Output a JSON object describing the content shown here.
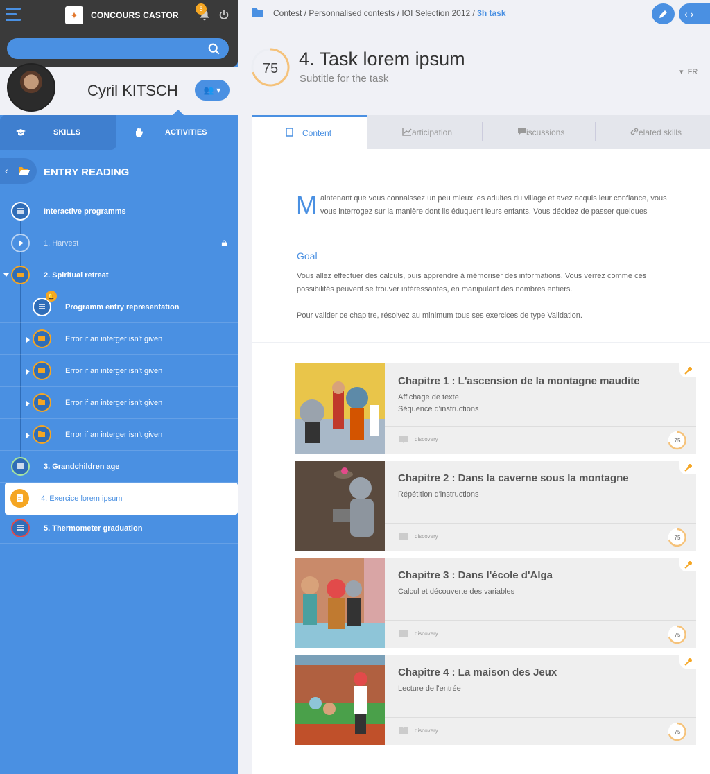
{
  "app": {
    "title": "CONCOURS CASTOR",
    "notification_count": "5"
  },
  "search": {
    "value": ""
  },
  "user": {
    "name": "Cyril KITSCH"
  },
  "tabs": {
    "skills": "SKILLS",
    "activities": "ACTIVITIES"
  },
  "sidebar": {
    "section_title": "ENTRY READING",
    "items": [
      {
        "label": "Interactive programms"
      },
      {
        "label": "1. Harvest"
      },
      {
        "label": "2. Spiritual retreat"
      },
      {
        "label": "Programm entry representation"
      },
      {
        "label": "Error if an interger isn't given"
      },
      {
        "label": "Error if an interger isn't given"
      },
      {
        "label": "Error if an interger isn't given"
      },
      {
        "label": "Error if an interger isn't given"
      },
      {
        "label": "3. Grandchildren age"
      },
      {
        "label": "4. Exercice lorem ipsum"
      },
      {
        "label": "5. Thermometer graduation"
      }
    ]
  },
  "breadcrumb": {
    "path": "Contest / Personnalised contests / IOI Selection 2012 /",
    "current": "3h task"
  },
  "task": {
    "score": "75",
    "title": "4. Task lorem ipsum",
    "subtitle": "Subtitle for the task",
    "language": "FR"
  },
  "content_tabs": [
    "Content",
    "articipation",
    "iscussions",
    "elated skills"
  ],
  "content": {
    "dropcap": "M",
    "intro": "aintenant que vous connaissez un peu mieux les adultes du village et avez acquis leur confiance, vous vous interrogez sur la manière dont ils éduquent leurs enfants. Vous décidez de passer quelques",
    "goal_title": "Goal",
    "goal_text": "Vous allez effectuer des calculs, puis apprendre à mémoriser des informations. Vous verrez comme ces possibilités peuvent se trouver intéressantes, en manipulant des nombres entiers.",
    "validation_text": "Pour valider ce chapitre, résolvez au minimum tous ses exercices de type Validation."
  },
  "chapters": [
    {
      "title": "Chapitre 1 : L'ascension de la montagne maudite",
      "line1": "Affichage de texte",
      "line2": "Séquence d'instructions",
      "tag": "discovery",
      "score": "75"
    },
    {
      "title": "Chapitre 2 : Dans la caverne sous la montagne",
      "line1": "Répétition d'instructions",
      "line2": "",
      "tag": "discovery",
      "score": "75"
    },
    {
      "title": "Chapitre 3 : Dans l'école d'Alga",
      "line1": "Calcul et découverte des variables",
      "line2": "",
      "tag": "discovery",
      "score": "75"
    },
    {
      "title": "Chapitre 4 : La maison des Jeux",
      "line1": "Lecture de l'entrée",
      "line2": "",
      "tag": "discovery",
      "score": "75"
    }
  ],
  "colors": {
    "accent": "#4a90e2",
    "orange": "#f5a623",
    "dark": "#3a3a3a"
  }
}
